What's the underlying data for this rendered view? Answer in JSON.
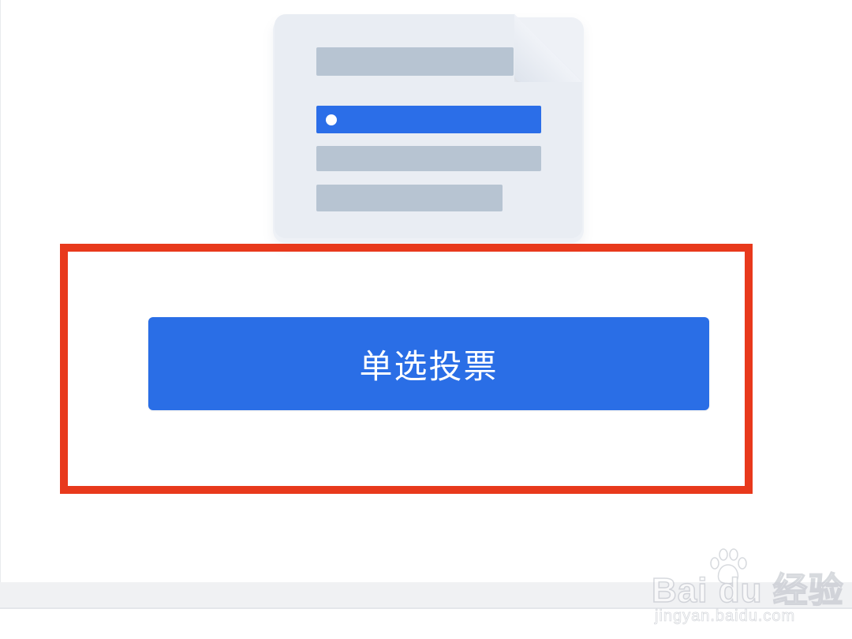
{
  "main": {
    "vote_button_label": "单选投票"
  },
  "illustration": {
    "icon": "single-choice-document-icon"
  },
  "colors": {
    "accent": "#2a6ee6",
    "highlight_border": "#e8391c",
    "doc_line": "#b7c4d2",
    "doc_page": "#e9edf3"
  },
  "watermark": {
    "brand": "Bai du 经验",
    "url": "jingyan.baidu.com"
  }
}
